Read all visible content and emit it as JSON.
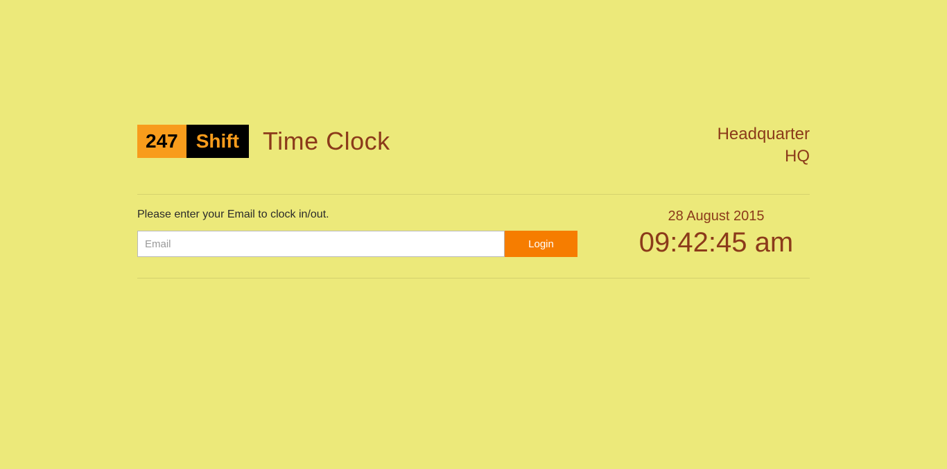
{
  "logo": {
    "left": "247",
    "right": "Shift"
  },
  "app_title": "Time Clock",
  "location": {
    "name": "Headquarter",
    "code": "HQ"
  },
  "prompt": "Please enter your Email to clock in/out.",
  "email_input": {
    "placeholder": "Email",
    "value": ""
  },
  "login_button_label": "Login",
  "clock": {
    "date": "28 August 2015",
    "time": "09:42:45 am"
  }
}
